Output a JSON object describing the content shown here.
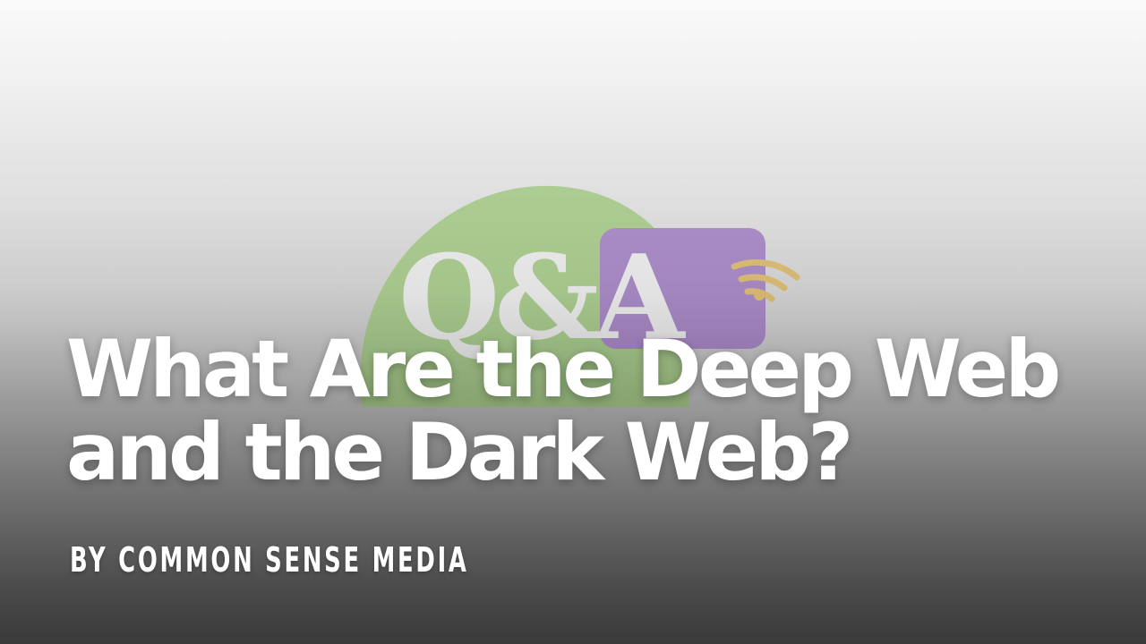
{
  "hero": {
    "logo": {
      "icon": "qa-speech-bubbles-logo",
      "text": "Q&A",
      "colors": {
        "green_bubble": "#8cc063",
        "purple_bubble": "#8b5bb8",
        "letters": "#f1f1f1",
        "wifi": "#d8a93a"
      }
    },
    "title_line1": "What Are the Deep Web",
    "title_line2": "and the Dark Web?",
    "byline": "By Common Sense Media"
  },
  "colors": {
    "text": "#ffffff",
    "background_top": "#fafafa",
    "background_bottom": "#555555"
  }
}
